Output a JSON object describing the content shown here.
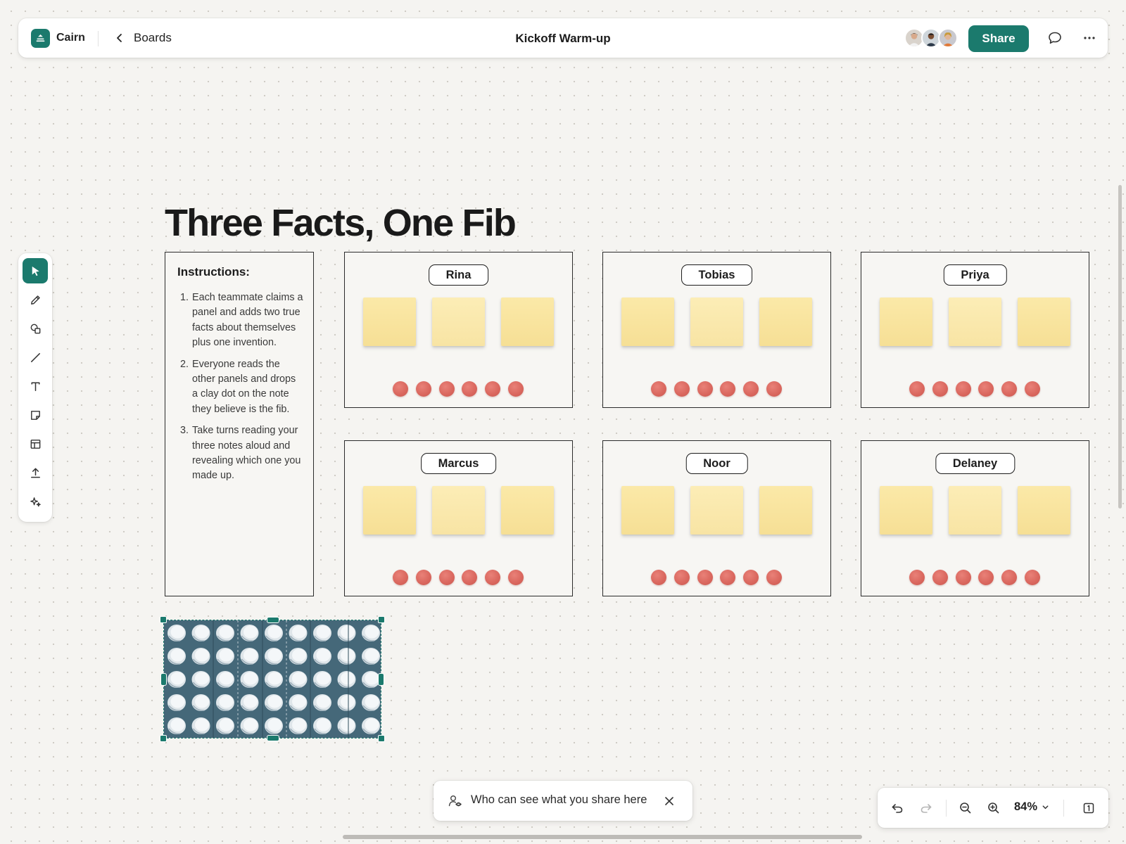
{
  "app": {
    "brand": "Cairn",
    "back_label": "Boards",
    "board_title": "Kickoff Warm-up",
    "share_label": "Share",
    "accent": "#1b7a6d"
  },
  "collaborators": [
    "avatar-woman",
    "avatar-man",
    "avatar-woman-blonde"
  ],
  "toolbar": {
    "tools": [
      "select-icon",
      "pencil-icon",
      "shapes-icon",
      "line-icon",
      "text-icon",
      "sticky-note-icon",
      "table-icon",
      "upload-icon",
      "ai-sparkle-icon"
    ],
    "active_tool": "select-icon"
  },
  "canvas": {
    "heading": "Three Facts, One Fib",
    "instructions": {
      "title": "Instructions:",
      "steps": [
        {
          "num": "1.",
          "text": "Each teammate claims a panel and adds two true facts about themselves plus one invention."
        },
        {
          "num": "2.",
          "text": "Everyone reads the other panels and drops a clay dot on the note they believe is the fib."
        },
        {
          "num": "3.",
          "text": "Take turns reading your three notes aloud and revealing which one you made up."
        }
      ]
    },
    "panels": [
      {
        "name": "Rina",
        "sticky_notes": 3,
        "dots": 6
      },
      {
        "name": "Tobias",
        "sticky_notes": 3,
        "dots": 6
      },
      {
        "name": "Priya",
        "sticky_notes": 3,
        "dots": 6
      },
      {
        "name": "Marcus",
        "sticky_notes": 3,
        "dots": 6
      },
      {
        "name": "Noor",
        "sticky_notes": 3,
        "dots": 6
      },
      {
        "name": "Delaney",
        "sticky_notes": 3,
        "dots": 6
      }
    ],
    "sticky_color": "#f8e4a0",
    "dot_color": "#d9665d"
  },
  "share_notice": {
    "text": "Who can see what you share here"
  },
  "zoom": {
    "level": "84%"
  }
}
